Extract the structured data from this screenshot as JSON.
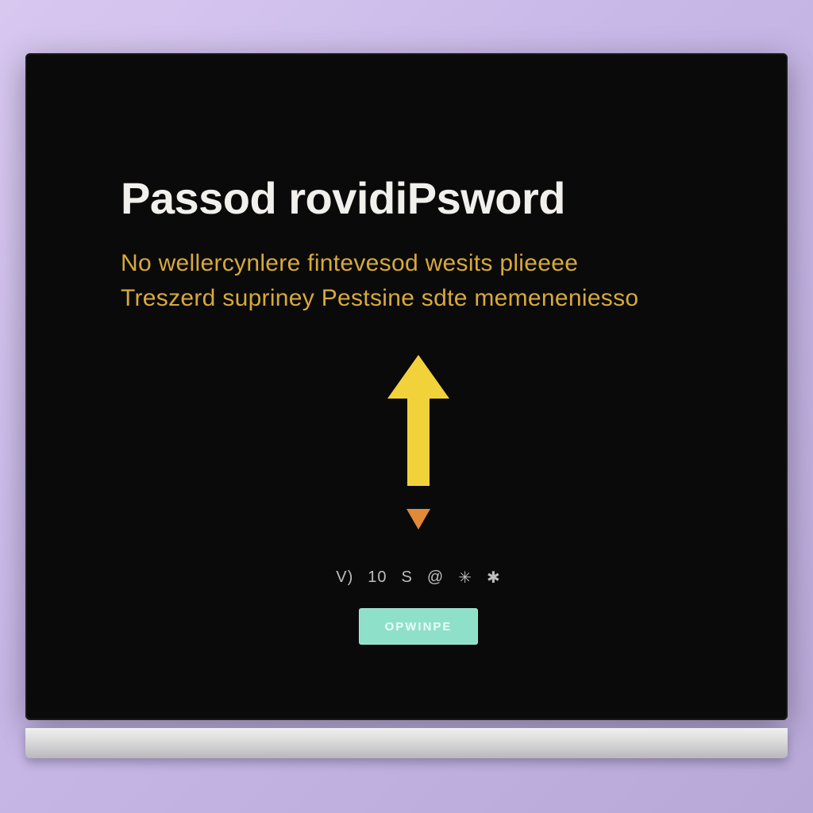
{
  "screen": {
    "title": "Passod rovidiPsword",
    "subtitle_line1": "No wellercynlere fintevesod wesits plieeee",
    "subtitle_line2": "Treszerd supriney Pestsine sdte memeneniesso",
    "code": {
      "c1": "V)",
      "c2": "10",
      "c3": "S",
      "c4": "@",
      "c5": "✳",
      "c6": "✱"
    },
    "button_label": "OPWINPE"
  },
  "colors": {
    "accent_yellow": "#f2d23a",
    "accent_orange": "#e08a3a",
    "button_bg": "#8fe0c8"
  }
}
